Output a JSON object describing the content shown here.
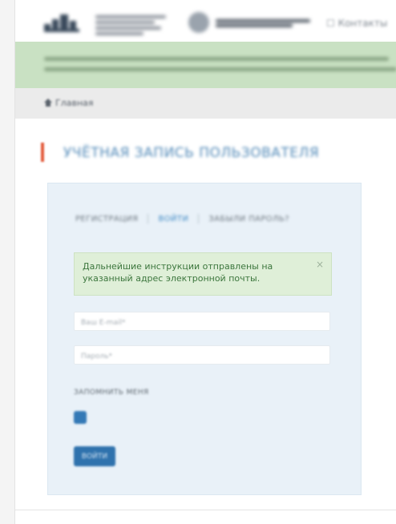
{
  "header": {
    "logo_icon": "organization-logo-icon",
    "emblem_icon": "state-emblem-icon",
    "link_label": "☐ Контакты"
  },
  "breadcrumb": {
    "home_icon": "home-icon",
    "label": "Главная"
  },
  "page": {
    "title": "УЧЁТНАЯ ЗАПИСЬ ПОЛЬЗОВАТЕЛЯ",
    "accent_color": "#e35c3d",
    "title_color": "#4f88b7"
  },
  "auth": {
    "tabs": [
      {
        "label": "РЕГИСТРАЦИЯ",
        "active": false
      },
      {
        "label": "ВОЙТИ",
        "active": true
      },
      {
        "label": "ЗАБЫЛИ ПАРОЛЬ?",
        "active": false
      }
    ],
    "alert": {
      "text": "Дальнейшие инструкции отправлены на указанный адрес электронной почты.",
      "close": "×",
      "background": "#dfefd8",
      "text_color": "#3c763d"
    },
    "email_placeholder": "Ваш E-mail*",
    "password_placeholder": "Пароль*",
    "remember_label": "ЗАПОМНИТЬ МЕНЯ",
    "remember_checked": true,
    "submit_label": "ВОЙТИ",
    "button_color": "#2f72ad"
  },
  "colors": {
    "notice_background": "#c9e1c3",
    "panel_background": "#e9f1f8",
    "breadcrumb_background": "#ebebeb"
  }
}
